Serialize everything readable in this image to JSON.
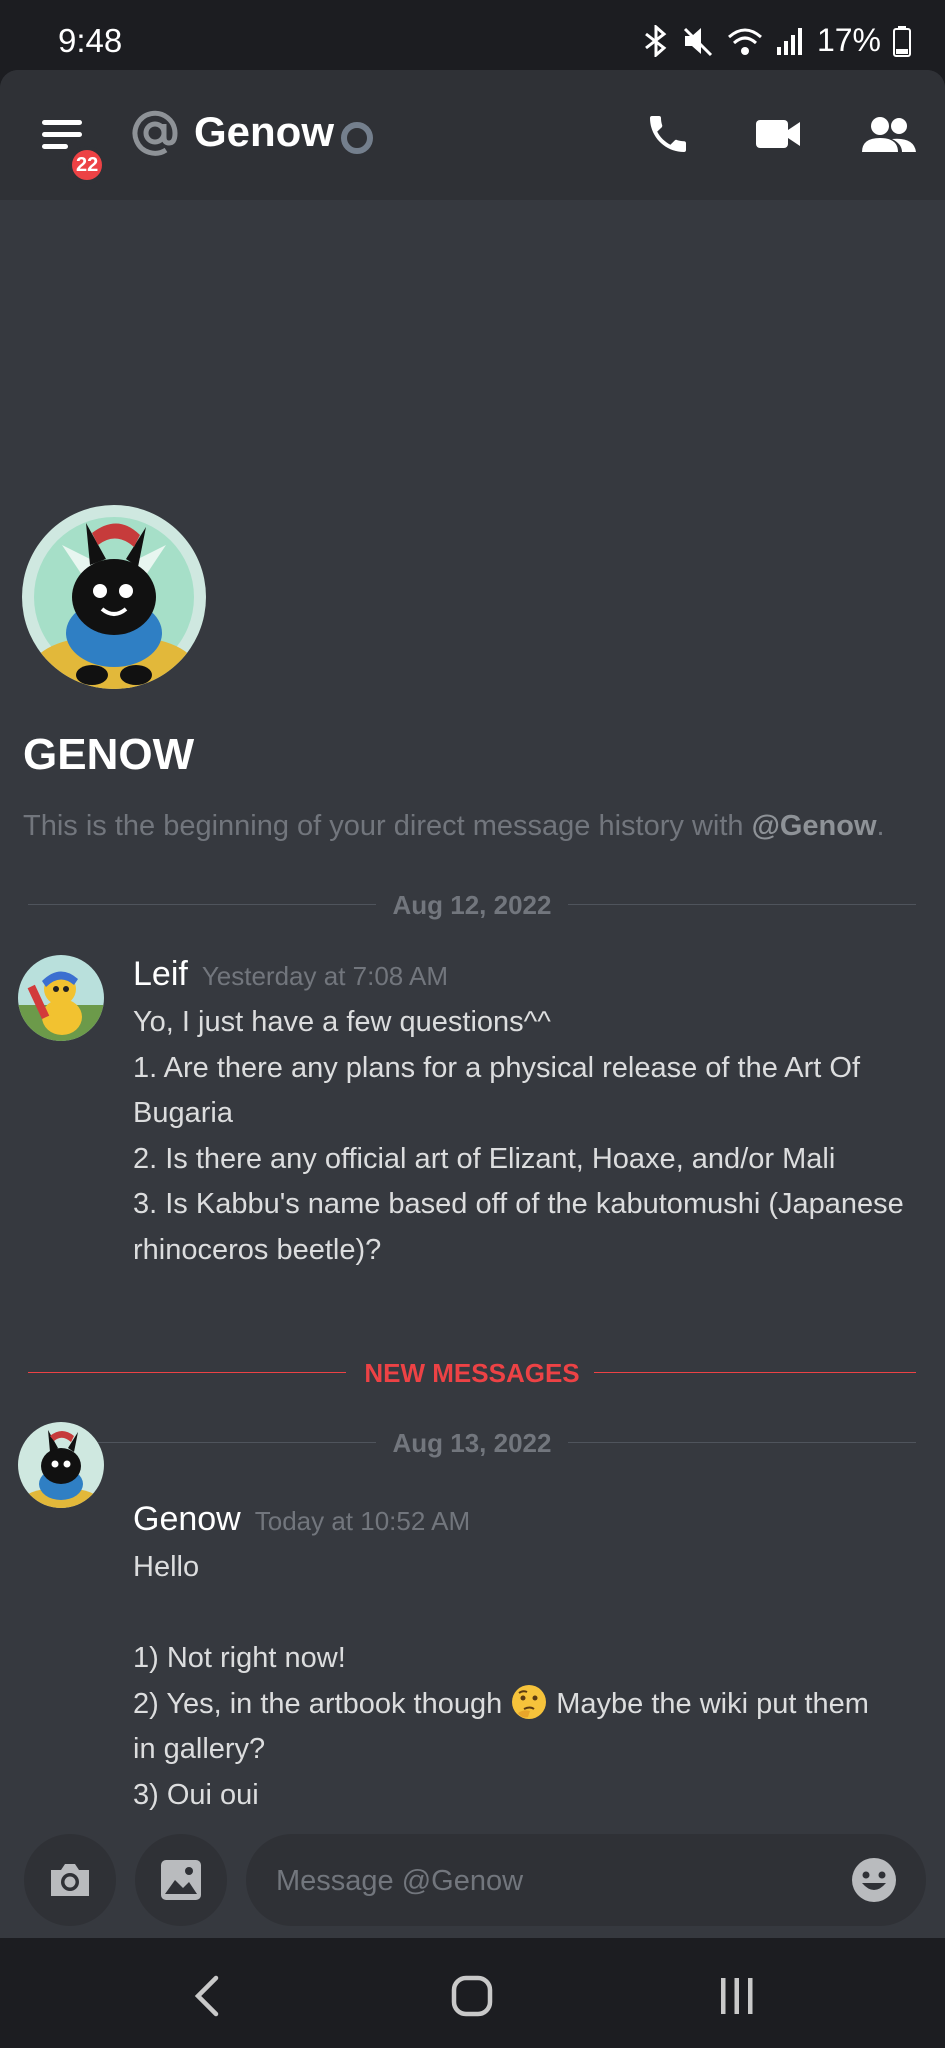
{
  "status_bar": {
    "time": "9:48",
    "battery": "17%"
  },
  "header": {
    "channel_name": "Genow",
    "unread_badge": "22"
  },
  "welcome": {
    "name": "GENOW",
    "text": "This is the beginning of your direct message history with ",
    "mention": "@Genow",
    "suffix": "."
  },
  "dividers": {
    "date1": "Aug 12, 2022",
    "new_messages": "NEW MESSAGES",
    "date2": "Aug 13, 2022"
  },
  "messages": [
    {
      "author": "Leif",
      "timestamp": "Yesterday at 7:08 AM",
      "lines": [
        "Yo, I just have a few questions^^",
        "1. Are there any plans for a physical release of the Art Of",
        "Bugaria",
        "2. Is there any official art of Elizant, Hoaxe, and/or Mali",
        "3. Is Kabbu's name based off of the kabutomushi (Japanese",
        "rhinoceros beetle)?"
      ]
    },
    {
      "author": "Genow",
      "timestamp": "Today at 10:52 AM",
      "lines": [
        "Hello",
        "",
        "1) Not right now!",
        "2) Yes, in the artbook though",
        "Maybe the wiki put them",
        "in gallery?",
        "3) Oui oui"
      ]
    }
  ],
  "composer": {
    "placeholder": "Message @Genow"
  },
  "icons": {
    "menu": "hamburger-menu-icon",
    "at": "at-sign-icon",
    "call": "phone-icon",
    "video": "video-camera-icon",
    "members": "members-icon",
    "camera": "camera-icon",
    "gallery": "image-icon",
    "emoji": "smiley-icon",
    "thinking": "thinking-face-emoji"
  },
  "colors": {
    "brand_red": "#ed4245",
    "background": "#36393f",
    "header": "#2f3136"
  }
}
